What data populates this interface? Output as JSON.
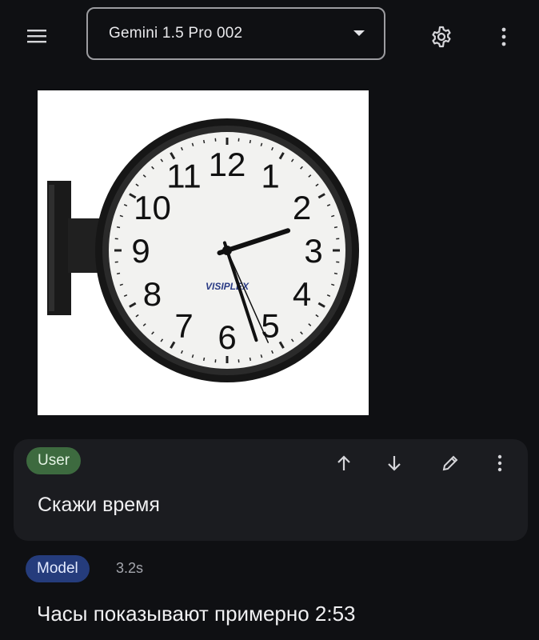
{
  "header": {
    "model_selector": {
      "value": "Gemini 1.5 Pro 002"
    },
    "icons": {
      "menu": "hamburger-menu-icon",
      "dropdown": "caret-down-icon",
      "settings": "gear-icon",
      "more": "more-vert-icon"
    }
  },
  "image": {
    "description_icon": "wall-clock-photo",
    "clock": {
      "numerals": [
        "12",
        "1",
        "2",
        "3",
        "4",
        "5",
        "6",
        "7",
        "8",
        "9",
        "10",
        "11"
      ],
      "brand": "VISIPLEX",
      "hands": {
        "hour": 2,
        "minute": 27,
        "second": 26
      }
    }
  },
  "user_message": {
    "role_badge": "User",
    "text": "Скажи время",
    "icons": [
      "arrow-up-icon",
      "arrow-down-icon",
      "edit-pencil-icon",
      "more-vert-icon"
    ]
  },
  "model_message": {
    "role_badge": "Model",
    "time": "3.2s",
    "text": "Часы показывают примерно 2:53"
  },
  "colors": {
    "background": "#0f1013",
    "card": "#1b1c20",
    "user_badge": "#3d6a3f",
    "model_badge": "#253c7c"
  }
}
